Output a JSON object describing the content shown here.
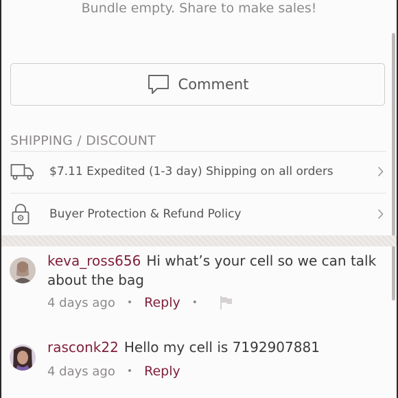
{
  "bundle": {
    "empty_text": "Bundle empty. Share to make sales!"
  },
  "comment_button": {
    "label": "Comment",
    "icon": "speech-bubble-icon"
  },
  "shipping_section": {
    "heading": "SHIPPING / DISCOUNT",
    "items": [
      {
        "icon": "truck-icon",
        "label": "$7.11 Expedited (1-3 day) Shipping on all orders"
      },
      {
        "icon": "lock-icon",
        "label": "Buyer Protection & Refund Policy"
      }
    ]
  },
  "comments": [
    {
      "username": "keva_ross656",
      "text": "Hi what’s your cell so we can talk about the bag",
      "time": "4 days ago",
      "reply_label": "Reply",
      "has_flag": true
    },
    {
      "username": "rasconk22",
      "text": "Hello my cell is 7192907881",
      "time": "4 days ago",
      "reply_label": "Reply",
      "has_flag": false
    }
  ],
  "colors": {
    "accent": "#7f1f3a",
    "muted_text": "#8c8989",
    "body_text": "#3a3a3a",
    "border": "#cfcbcb"
  }
}
